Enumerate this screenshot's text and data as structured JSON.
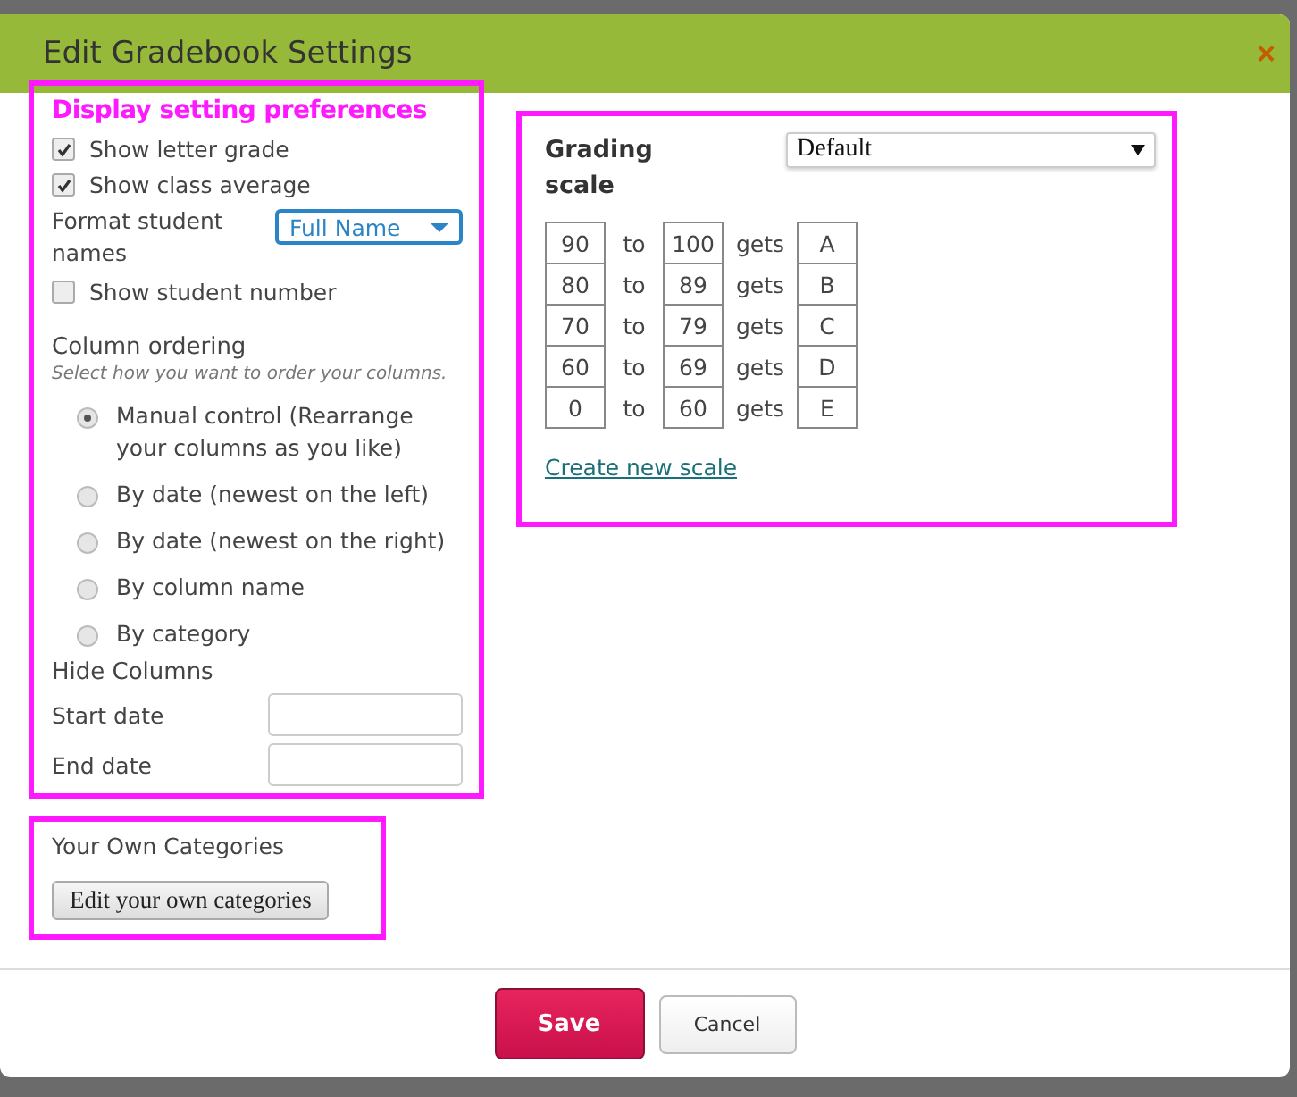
{
  "dialog": {
    "title": "Edit Gradebook Settings",
    "close": "×"
  },
  "display": {
    "heading": "Display setting preferences",
    "checks": [
      {
        "label": "Show letter grade",
        "checked": true
      },
      {
        "label": "Show class average",
        "checked": true
      }
    ],
    "format": {
      "label": "Format student names",
      "value": "Full Name"
    },
    "student_number": {
      "label": "Show student number",
      "checked": false
    },
    "ordering": {
      "heading": "Column ordering",
      "hint": "Select how you want to order your columns.",
      "options": [
        {
          "label": "Manual control (Rearrange your columns as you like)",
          "selected": true
        },
        {
          "label": "By date (newest on the left)",
          "selected": false
        },
        {
          "label": "By date (newest on the right)",
          "selected": false
        },
        {
          "label": "By column name",
          "selected": false
        },
        {
          "label": "By category",
          "selected": false
        }
      ]
    },
    "hide": {
      "heading": "Hide Columns",
      "fields": [
        {
          "label": "Start date"
        },
        {
          "label": "End date"
        }
      ]
    }
  },
  "categories": {
    "heading": "Your Own Categories",
    "button": "Edit your own categories"
  },
  "grading": {
    "heading": "Grading scale",
    "scale": "Default",
    "rows": [
      {
        "from": "90",
        "to_word": "to",
        "to": "100",
        "gets": "gets",
        "grade": "A"
      },
      {
        "from": "80",
        "to_word": "to",
        "to": "89",
        "gets": "gets",
        "grade": "B"
      },
      {
        "from": "70",
        "to_word": "to",
        "to": "79",
        "gets": "gets",
        "grade": "C"
      },
      {
        "from": "60",
        "to_word": "to",
        "to": "69",
        "gets": "gets",
        "grade": "D"
      },
      {
        "from": "0",
        "to_word": "to",
        "to": "60",
        "gets": "gets",
        "grade": "E"
      }
    ],
    "link": "Create new scale"
  },
  "footer": {
    "save": "Save",
    "cancel": "Cancel"
  }
}
